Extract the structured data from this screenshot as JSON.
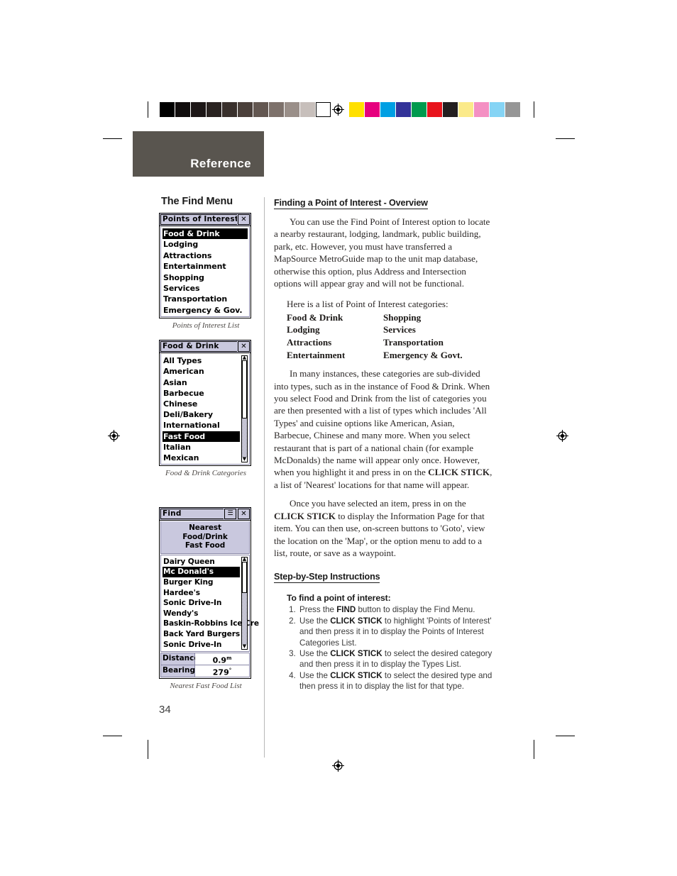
{
  "prepress": {
    "gray_swatches": [
      "#000000",
      "#110d0d",
      "#1d1717",
      "#2a2321",
      "#39302c",
      "#4b403b",
      "#635751",
      "#7d716b",
      "#9a8f89",
      "#c7bfbb",
      "#ffffff"
    ],
    "color_swatches": [
      "#ffe000",
      "#e6007e",
      "#009fe3",
      "#333399",
      "#009a4e",
      "#e8141c",
      "#231f20",
      "#fbea8a",
      "#f490c3",
      "#85d4f5",
      "#969696"
    ],
    "registration_icon": "registration-target-icon"
  },
  "tab": {
    "label": "Reference"
  },
  "page": {
    "number": "34"
  },
  "left": {
    "heading": "The Find Menu",
    "poi_window": {
      "title": "Points of Interest",
      "close_icon": "✕",
      "items": [
        "Food & Drink",
        "Lodging",
        "Attractions",
        "Entertainment",
        "Shopping",
        "Services",
        "Transportation",
        "Emergency & Gov."
      ],
      "selected_index": 0,
      "caption": "Points of Interest List"
    },
    "category_window": {
      "title": "Food & Drink",
      "close_icon": "✕",
      "items": [
        "All Types",
        "American",
        "Asian",
        "Barbecue",
        "Chinese",
        "Deli/Bakery",
        "International",
        "Fast Food",
        "Italian",
        "Mexican"
      ],
      "selected_index": 7,
      "scroll_up_icon": "▲",
      "scroll_down_icon": "▼",
      "caption": "Food & Drink Categories"
    },
    "find_window": {
      "title": "Find",
      "menu_icon": "☰",
      "close_icon": "✕",
      "header_lines": [
        "Nearest",
        "Food/Drink",
        "Fast Food"
      ],
      "items": [
        "Dairy Queen",
        "Mc Donald's",
        "Burger King",
        "Hardee's",
        "Sonic Drive-In",
        "Wendy's",
        "Baskin-Robbins Ice Cre",
        "Back Yard Burgers",
        "Sonic Drive-In"
      ],
      "selected_index": 1,
      "scroll_up_icon": "▲",
      "scroll_down_icon": "▼",
      "fields": [
        {
          "label": "Distance",
          "value": "0.9",
          "unit": "m"
        },
        {
          "label": "Bearing",
          "value": "279",
          "unit": "°"
        }
      ],
      "caption": "Nearest Fast Food List"
    }
  },
  "right": {
    "overview_heading": "Finding a Point of Interest - Overview",
    "overview_p1": "You can use the Find Point of Interest option to locate a nearby restaurant, lodging, landmark, public building, park, etc. However, you must have transferred a MapSource MetroGuide map to the unit map database, otherwise this option, plus Address and Intersection options will appear gray and will not be functional.",
    "categories_intro": "Here is a list of Point of Interest categories:",
    "categories": [
      "Food & Drink",
      "Shopping",
      "Lodging",
      "Services",
      "Attractions",
      "Transportation",
      "Entertainment",
      "Emergency & Govt."
    ],
    "overview_p2_a": "In many instances, these categories are sub-divided into types, such as in the instance of Food & Drink. When you select Food and Drink from the list of categories you are then presented with a list of types which includes 'All Types' and cuisine options like American, Asian, Barbecue, Chinese and many more. When you select restaurant that is part of a national chain (for example McDonalds) the name will appear only once. However, when you highlight it and press in on the ",
    "overview_p2_bold": "CLICK STICK",
    "overview_p2_b": ", a list of 'Nearest'  locations for that name will appear.",
    "overview_p3_a": "Once you have selected an item, press in on the ",
    "overview_p3_bold": "CLICK STICK",
    "overview_p3_b": " to display the Information Page for that item. You can then use, on-screen buttons to 'Goto', view the location on the 'Map', or the option menu to add to a list, route, or save as a waypoint.",
    "steps_heading": "Step-by-Step Instructions",
    "steps_title": "To find a point of interest:",
    "steps": [
      {
        "a": "Press the ",
        "bold": "FIND",
        "b": " button to display the Find Menu."
      },
      {
        "a": "Use the ",
        "bold": "CLICK STICK",
        "b": " to highlight 'Points of Interest' and then press it in to display the Points of Interest Categories List."
      },
      {
        "a": "Use the ",
        "bold": "CLICK STICK",
        "b": " to select the desired category and then press it in to display the Types List."
      },
      {
        "a": "Use the ",
        "bold": "CLICK STICK",
        "b": " to select the desired type and then press it in to display the list for that type."
      }
    ]
  }
}
